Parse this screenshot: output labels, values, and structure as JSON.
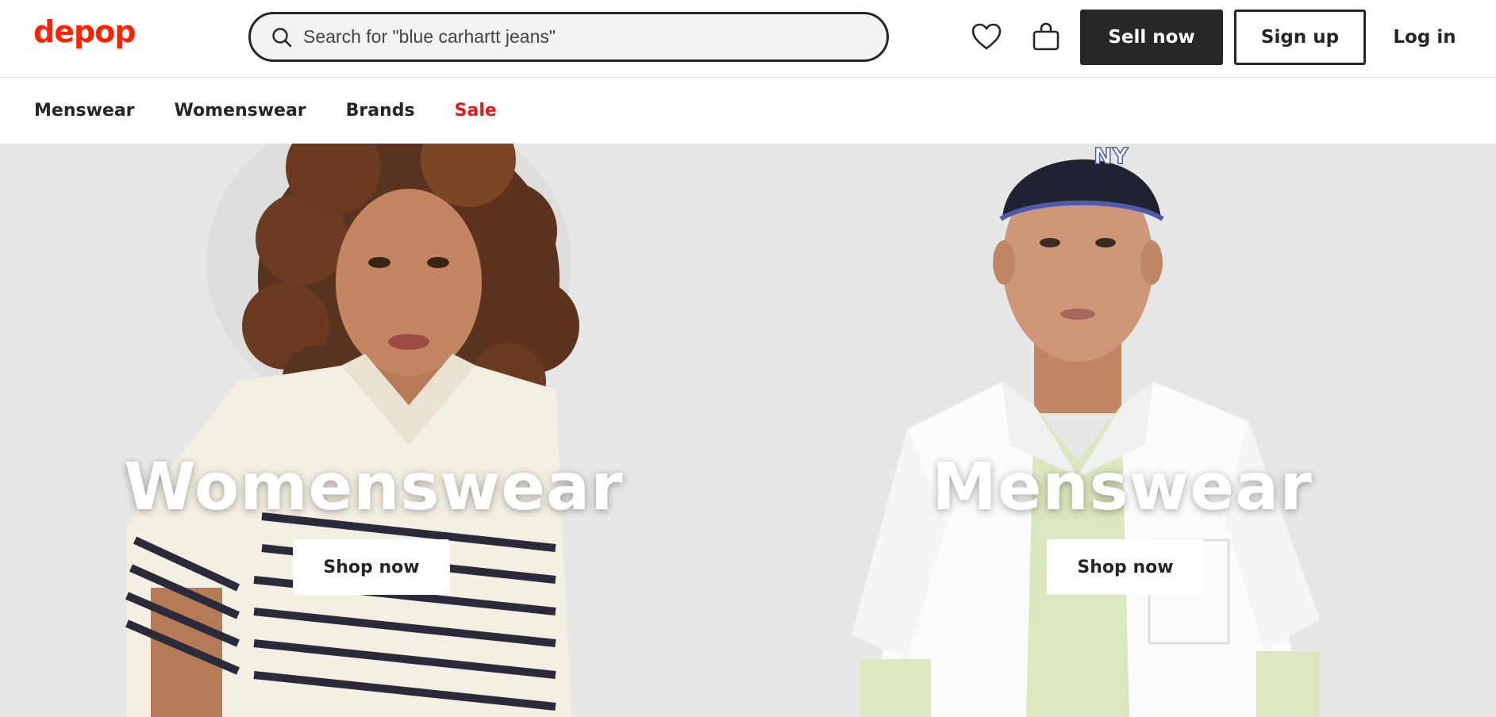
{
  "header": {
    "logo": "depop",
    "search": {
      "value": "",
      "placeholder": "Search for \"blue carhartt jeans\""
    },
    "icons": {
      "favorites": "heart-icon",
      "bag": "shopping-bag-icon",
      "search": "search-icon"
    },
    "sell_label": "Sell now",
    "signup_label": "Sign up",
    "login_label": "Log in"
  },
  "nav": {
    "items": [
      "Menswear",
      "Womenswear",
      "Brands",
      "Sale"
    ]
  },
  "hero": {
    "panels": [
      {
        "title": "Womenswear",
        "button": "Shop now"
      },
      {
        "title": "Menswear",
        "button": "Shop now"
      }
    ]
  },
  "colors": {
    "brand": "#ff2300",
    "sale": "#e01a1a",
    "dark": "#262626",
    "hero_bg": "#e7e7e7"
  }
}
